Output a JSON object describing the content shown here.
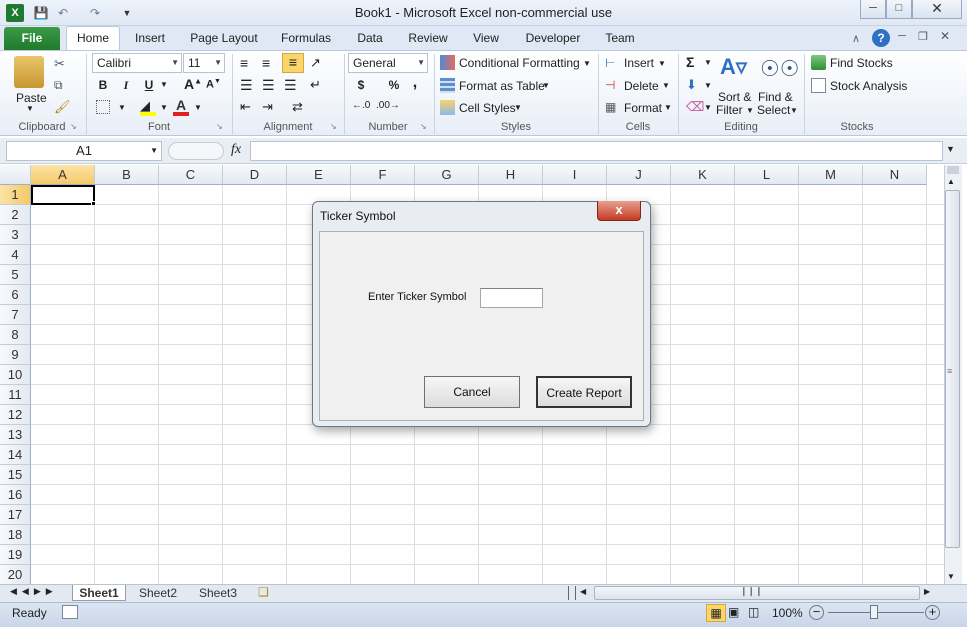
{
  "window": {
    "title": "Book1  -  Microsoft Excel non-commercial use"
  },
  "tabs": {
    "file": "File",
    "items": [
      "Home",
      "Insert",
      "Page Layout",
      "Formulas",
      "Data",
      "Review",
      "View",
      "Developer",
      "Team"
    ]
  },
  "ribbon": {
    "clipboard": {
      "paste": "Paste",
      "label": "Clipboard"
    },
    "font": {
      "name": "Calibri",
      "size": "11",
      "bold": "B",
      "italic": "I",
      "underline": "U",
      "label": "Font"
    },
    "alignment": {
      "label": "Alignment"
    },
    "number": {
      "format": "General",
      "currency": "$",
      "percent": "%",
      "comma": ",",
      "label": "Number"
    },
    "styles": {
      "conditional": "Conditional Formatting",
      "table": "Format as Table",
      "cell": "Cell Styles",
      "label": "Styles"
    },
    "cells": {
      "insert": "Insert",
      "delete": "Delete",
      "format": "Format",
      "label": "Cells"
    },
    "editing": {
      "sort1": "Sort &",
      "sort2": "Filter",
      "find1": "Find &",
      "find2": "Select",
      "label": "Editing"
    },
    "stocks": {
      "find": "Find Stocks",
      "analysis": "Stock Analysis",
      "label": "Stocks"
    }
  },
  "formula_bar": {
    "name_box": "A1",
    "fx": "fx"
  },
  "grid": {
    "columns": [
      "A",
      "B",
      "C",
      "D",
      "E",
      "F",
      "G",
      "H",
      "I",
      "J",
      "K",
      "L",
      "M",
      "N"
    ],
    "rows": [
      "1",
      "2",
      "3",
      "4",
      "5",
      "6",
      "7",
      "8",
      "9",
      "10",
      "11",
      "12",
      "13",
      "14",
      "15",
      "16",
      "17",
      "18",
      "19",
      "20"
    ],
    "selected_cell": "A1"
  },
  "sheets": [
    "Sheet1",
    "Sheet2",
    "Sheet3"
  ],
  "status": {
    "ready": "Ready",
    "zoom": "100%"
  },
  "dialog": {
    "title": "Ticker Symbol",
    "close": "x",
    "label": "Enter Ticker Symbol",
    "input_value": "",
    "cancel": "Cancel",
    "create": "Create Report"
  }
}
